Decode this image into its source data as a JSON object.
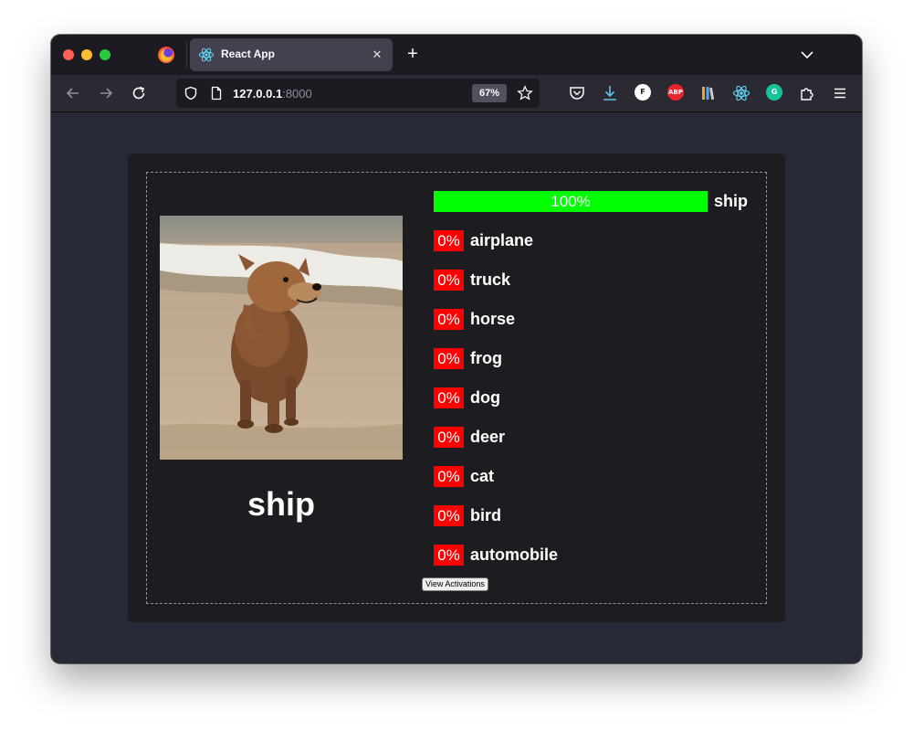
{
  "browser": {
    "tab_title": "React App",
    "url_host": "127.0.0.1",
    "url_port": ":8000",
    "zoom": "67%",
    "icons": [
      "firefox-icon",
      "react-favicon",
      "close-icon",
      "plus-icon",
      "chevron-down-icon",
      "back-arrow-icon",
      "forward-arrow-icon",
      "reload-icon",
      "shield-icon",
      "page-icon",
      "star-icon",
      "pocket-icon",
      "download-icon",
      "f-extension-icon",
      "adblock-plus-icon",
      "library-icon",
      "react-devtools-icon",
      "grammarly-icon",
      "extensions-icon",
      "menu-icon"
    ],
    "extensions": {
      "f_label": "F",
      "abp_label": "ABP",
      "grammarly_label": "G"
    }
  },
  "app": {
    "prediction": "ship",
    "image_subject": "dog on beach",
    "view_button": "View Activations",
    "colors": {
      "high": "#00ff00",
      "low": "#ff0000",
      "card": "#1c1c21",
      "page": "#272a36"
    },
    "results": [
      {
        "label": "ship",
        "percent": "100%",
        "value": 1.0
      },
      {
        "label": "airplane",
        "percent": "0%",
        "value": 0
      },
      {
        "label": "truck",
        "percent": "0%",
        "value": 0
      },
      {
        "label": "horse",
        "percent": "0%",
        "value": 0
      },
      {
        "label": "frog",
        "percent": "0%",
        "value": 0
      },
      {
        "label": "dog",
        "percent": "0%",
        "value": 0
      },
      {
        "label": "deer",
        "percent": "0%",
        "value": 0
      },
      {
        "label": "cat",
        "percent": "0%",
        "value": 0
      },
      {
        "label": "bird",
        "percent": "0%",
        "value": 0
      },
      {
        "label": "automobile",
        "percent": "0%",
        "value": 0
      }
    ]
  }
}
